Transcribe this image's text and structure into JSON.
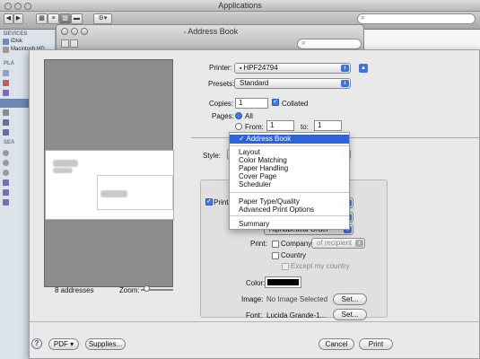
{
  "finder": {
    "title": "Applications"
  },
  "sidebar": {
    "devices_header": "DEVICES",
    "places_header": "PLA",
    "search_header": "SEA",
    "items": [
      {
        "label": "iDisk"
      },
      {
        "label": "Macintosh HD"
      }
    ]
  },
  "address_book_window": {
    "title": "Address Book"
  },
  "print": {
    "printer_label": "Printer:",
    "printer_value": "HPF24794",
    "presets_label": "Presets:",
    "presets_value": "Standard",
    "copies_label": "Copies:",
    "copies_value": "1",
    "collated_label": "Collated",
    "collated_checked": true,
    "pages_label": "Pages:",
    "all_label": "All",
    "from_label": "From:",
    "from_value": "1",
    "to_label": "to:",
    "to_value": "1",
    "style_label": "Style:",
    "print_checkbox_label": "Print",
    "print_in_value": "Alphabetical Order",
    "print2_label": "Print:",
    "company_label": "Company",
    "of_recipient_value": "of recipient",
    "country_label": "Country",
    "except_label": "Except my country",
    "color_label": "Color:",
    "image_label": "Image:",
    "image_value": "No Image Selected",
    "font_label": "Font:",
    "font_value": "Lucida Grande-1...",
    "set_label": "Set...",
    "addresses_count": "8 addresses",
    "zoom_label": "Zoom:",
    "pdf_label": "PDF ▾",
    "supplies_label": "Supplies...",
    "cancel_label": "Cancel",
    "print_button_label": "Print",
    "help_label": "?"
  },
  "dropdown_menu": {
    "items": [
      {
        "label": "✓ Address Book",
        "selected": true
      },
      {
        "label": "Layout"
      },
      {
        "label": "Color Matching"
      },
      {
        "label": "Paper Handling"
      },
      {
        "label": "Cover Page"
      },
      {
        "label": "Scheduler"
      },
      {
        "label": "Paper Type/Quality"
      },
      {
        "label": "Advanced Print Options"
      },
      {
        "label": "Summary"
      }
    ]
  },
  "colors": {
    "accent": "#2f63d8",
    "swatch": "#000000"
  }
}
